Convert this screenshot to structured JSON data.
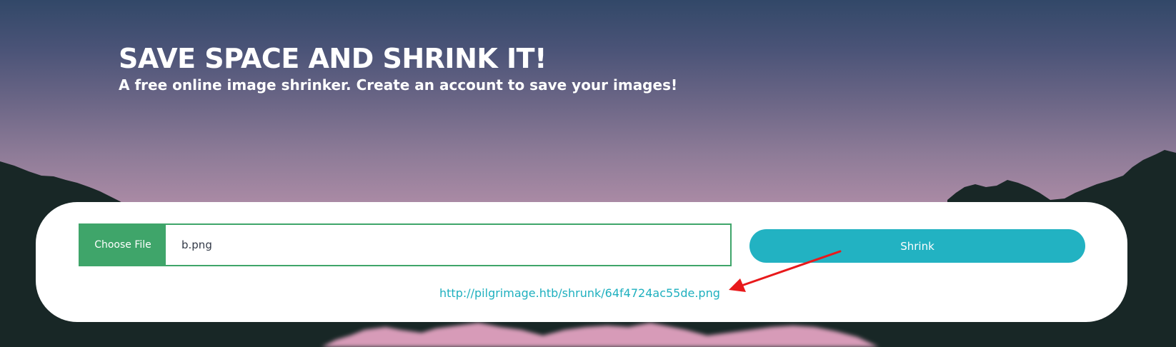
{
  "hero": {
    "title": "SAVE SPACE AND SHRINK IT!",
    "subtitle": "A free online image shrinker. Create an account to save your images!"
  },
  "upload": {
    "choose_label": "Choose File",
    "file_name": "b.png",
    "shrink_label": "Shrink",
    "result_url": "http://pilgrimage.htb/shrunk/64f4724ac55de.png"
  },
  "colors": {
    "accent_green": "#3fa56a",
    "accent_teal": "#22b2c2",
    "link": "#1fb0bf",
    "annotation_arrow": "#e8191b"
  },
  "icons": {
    "annotation": "red-arrow"
  }
}
